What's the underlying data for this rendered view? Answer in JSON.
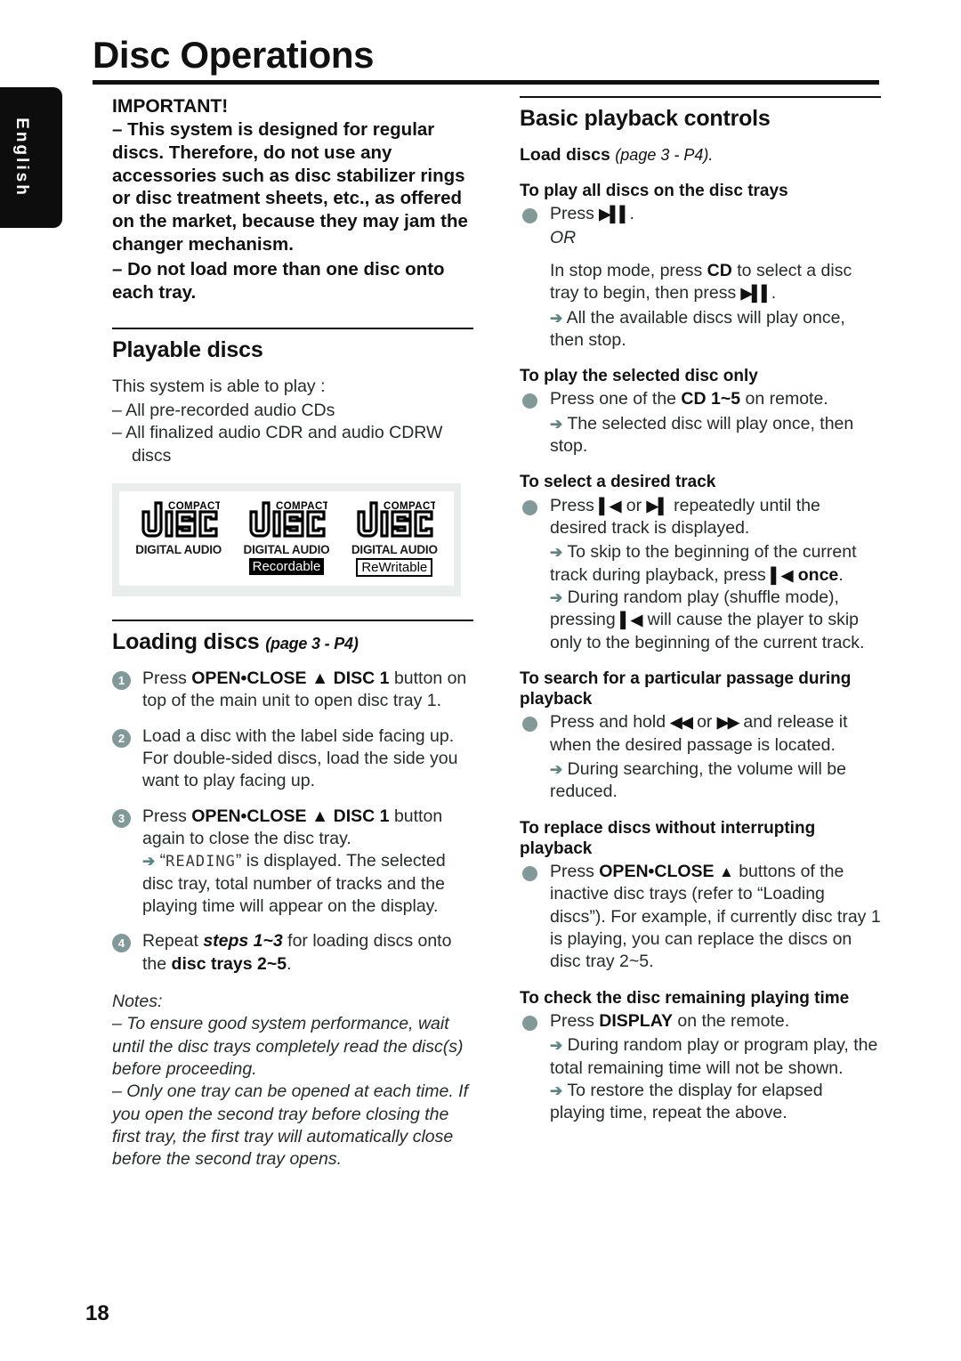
{
  "sidebar": {
    "language_tab": "English"
  },
  "header": {
    "title": "Disc Operations"
  },
  "footer": {
    "page_number": "18"
  },
  "colors": {
    "bullet": "#82999a",
    "arrow": "#5c8583",
    "logo_band_bg": "#e9edec",
    "rule": "#111111"
  },
  "left_column": {
    "important": {
      "title": "IMPORTANT!",
      "items": [
        "–  This system is designed for regular discs. Therefore, do not use any accessories such as disc stabilizer rings or disc treatment sheets, etc., as offered on the market, because they may jam the changer mechanism.",
        "–  Do not load more than one disc onto each tray."
      ]
    },
    "playable_discs": {
      "heading": "Playable discs",
      "intro": "This system is able to play :",
      "items": [
        "–   All pre-recorded audio CDs",
        "–   All finalized audio CDR and audio CDRW discs"
      ]
    },
    "disc_logos": [
      {
        "name": "compact-disc-digital-audio",
        "line1": "COMPACT",
        "line2": "DIGITAL AUDIO",
        "tag": ""
      },
      {
        "name": "compact-disc-digital-audio-recordable",
        "line1": "COMPACT",
        "line2": "DIGITAL AUDIO",
        "tag": "Recordable"
      },
      {
        "name": "compact-disc-digital-audio-rewritable",
        "line1": "COMPACT",
        "line2": "DIGITAL AUDIO",
        "tag": "ReWritable"
      }
    ],
    "loading_discs": {
      "heading": "Loading discs",
      "page_ref": "(page 3 - P4)",
      "steps": [
        {
          "num": "1",
          "html": "Press <b>OPEN•CLOSE &#9650;&#8203; DISC 1</b> button on top of the main unit to open disc tray 1."
        },
        {
          "num": "2",
          "html": "Load a disc with the label side facing up. For double-sided discs, load the side you want to play facing up."
        },
        {
          "num": "3",
          "html": "Press <b>OPEN•CLOSE &#9650; DISC 1</b> button again to close the disc tray."
        },
        {
          "num": "4",
          "html": "Repeat <b><i>steps 1~3</i></b> for loading discs onto the <b>disc trays 2~5</b>."
        }
      ],
      "step3_note": "\"READING\" is displayed. The selected disc tray, total number of tracks and the playing time will appear on the display.",
      "step3_note_lcd": "READING"
    },
    "notes": {
      "label": "Notes:",
      "items": [
        "–  To ensure good system performance, wait until the disc trays completely read the disc(s) before proceeding.",
        "–  Only one tray can be opened at each time.  If you open the second tray before closing the first tray, the first tray will automatically close before the second tray opens."
      ]
    }
  },
  "right_column": {
    "heading": "Basic playback controls",
    "load_discs": {
      "label": "Load discs",
      "page_ref": "(page 3 - P4)."
    },
    "sections": [
      {
        "id": "play-all-discs",
        "heading": "To play all discs on the disc trays",
        "bullet": "Press",
        "or": "OR",
        "lines": [
          "In stop mode, press CD to select a disc tray to begin, then press"
        ],
        "arrows": [
          "All the available discs will play once, then stop."
        ]
      },
      {
        "id": "play-selected-disc",
        "heading": "To play the selected disc only",
        "bullet": "Press one of the CD 1~5 on remote.",
        "arrows": [
          "The selected disc will play once, then stop."
        ]
      },
      {
        "id": "select-track",
        "heading": "To select a desired track",
        "bullet": "Press  or  repeatedly until the desired track is displayed.",
        "arrows": [
          "To skip to the beginning of the current track during playback, press  once.",
          "During random play (shuffle mode), pressing  will cause the player to skip only to the beginning of the current track."
        ]
      },
      {
        "id": "search-passage",
        "heading": "To search for a particular passage during playback",
        "bullet": "Press and hold  or  and release it when the desired passage is located.",
        "arrows": [
          "During searching, the volume will be reduced."
        ]
      },
      {
        "id": "replace-discs",
        "heading": "To replace discs without interrupting playback",
        "bullet": "Press OPEN•CLOSE buttons of the inactive disc trays (refer to \"Loading discs\"). For example, if currently disc tray 1 is playing, you can replace the discs on disc tray 2~5.",
        "arrows": []
      },
      {
        "id": "check-remaining-time",
        "heading": "To check the disc remaining playing time",
        "bullet": "Press DISPLAY on the remote.",
        "arrows": [
          "During random play or program play, the total remaining time will not be shown.",
          "To restore the display for elapsed playing time, repeat the above."
        ]
      }
    ]
  }
}
